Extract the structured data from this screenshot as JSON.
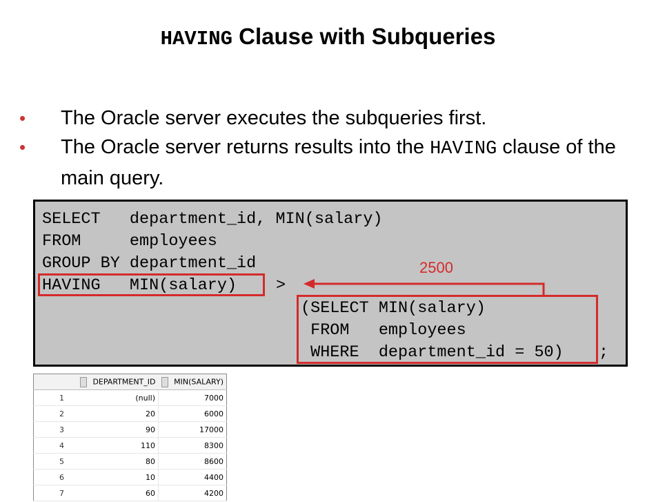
{
  "title": {
    "mono": "HAVING",
    "rest": " Clause with Subqueries"
  },
  "bullets": [
    {
      "text": "The Oracle server executes the subqueries first."
    },
    {
      "pre": "The Oracle server returns results into the ",
      "mono": "HAVING",
      "post": " clause of the main query."
    }
  ],
  "bullet_symbol": "•",
  "code": {
    "line1": "SELECT   department_id, MIN(salary)",
    "line2": "FROM     employees",
    "line3": "GROUP BY department_id",
    "line4a": "HAVING   MIN(salary)",
    "line4b": ">",
    "sub1": "(SELECT MIN(salary)",
    "sub2": " FROM   employees",
    "sub3": " WHERE  department_id = 50)",
    "semicolon": ";"
  },
  "annotation": "2500",
  "colors": {
    "accent": "#d42a2a",
    "code_bg": "#c4c4c4"
  },
  "table": {
    "headers": [
      "DEPARTMENT_ID",
      "MIN(SALARY)"
    ],
    "rows": [
      [
        "1",
        "(null)",
        "7000"
      ],
      [
        "2",
        "20",
        "6000"
      ],
      [
        "3",
        "90",
        "17000"
      ],
      [
        "4",
        "110",
        "8300"
      ],
      [
        "5",
        "80",
        "8600"
      ],
      [
        "6",
        "10",
        "4400"
      ],
      [
        "7",
        "60",
        "4200"
      ]
    ]
  }
}
